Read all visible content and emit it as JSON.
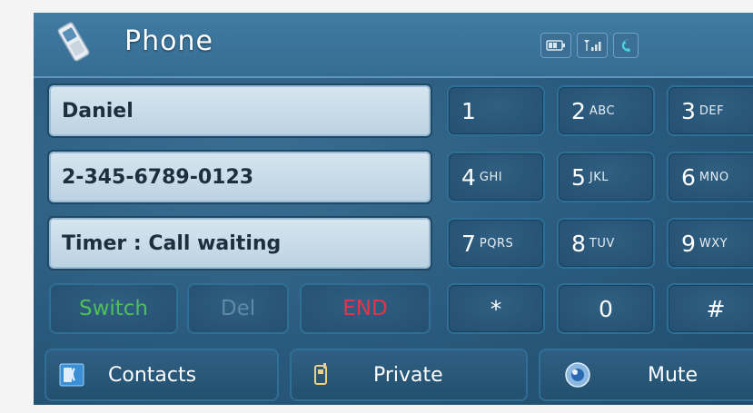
{
  "header": {
    "title": "Phone",
    "icons": [
      "phone-icon",
      "battery-icon",
      "signal-icon",
      "call-icon"
    ]
  },
  "fields": {
    "name": "Daniel",
    "number": "2-345-6789-0123",
    "status": "Timer : Call waiting"
  },
  "actions": {
    "switch": "Switch",
    "del": "Del",
    "end": "END"
  },
  "keypad": [
    {
      "digit": "1",
      "letters": ""
    },
    {
      "digit": "2",
      "letters": "ABC"
    },
    {
      "digit": "3",
      "letters": "DEF"
    },
    {
      "digit": "4",
      "letters": "GHI"
    },
    {
      "digit": "5",
      "letters": "JKL"
    },
    {
      "digit": "6",
      "letters": "MNO"
    },
    {
      "digit": "7",
      "letters": "PQRS"
    },
    {
      "digit": "8",
      "letters": "TUV"
    },
    {
      "digit": "9",
      "letters": "WXY"
    },
    {
      "digit": "*",
      "letters": ""
    },
    {
      "digit": "0",
      "letters": ""
    },
    {
      "digit": "#",
      "letters": ""
    }
  ],
  "bottom": {
    "contacts": "Contacts",
    "private": "Private",
    "mute": "Mute"
  },
  "colors": {
    "switch": "#4fbf5a",
    "del": "#5f8aa6",
    "end": "#e0354a"
  }
}
